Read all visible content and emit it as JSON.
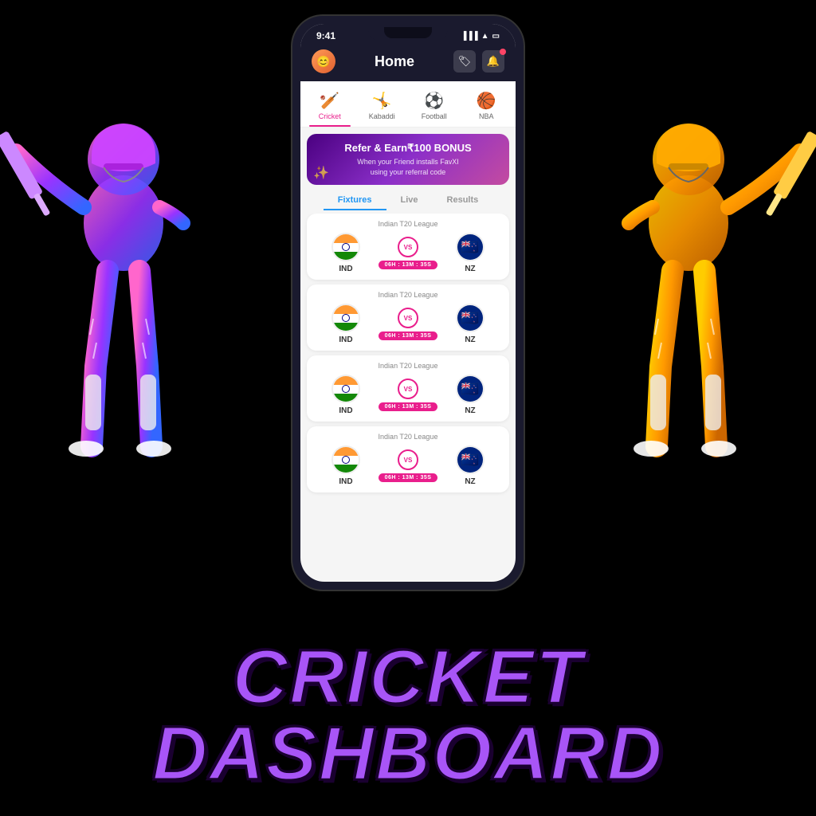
{
  "page": {
    "background": "#000000",
    "title": "CRICKET DASHBOARD"
  },
  "status_bar": {
    "time": "9:41",
    "signal": "▐▐▐",
    "wifi": "WiFi",
    "battery": "🔋"
  },
  "header": {
    "title": "Home",
    "avatar_icon": "👤",
    "tag_icon": "🏷",
    "bell_icon": "🔔"
  },
  "sport_tabs": [
    {
      "label": "Cricket",
      "icon": "🏏",
      "active": true
    },
    {
      "label": "Kabaddi",
      "icon": "🤸",
      "active": false
    },
    {
      "label": "Football",
      "icon": "⚽",
      "active": false
    },
    {
      "label": "NBA",
      "icon": "🏀",
      "active": false
    }
  ],
  "banner": {
    "title": "Refer & Earn₹100 BONUS",
    "subtitle": "When your Friend installs FavXI\nusing your referral code"
  },
  "match_tabs": [
    {
      "label": "Fixtures",
      "active": true
    },
    {
      "label": "Live",
      "active": false
    },
    {
      "label": "Results",
      "active": false
    }
  ],
  "matches": [
    {
      "league": "Indian T20 League",
      "team1": "IND",
      "team2": "NZ",
      "timer": "06H : 13M : 35S"
    },
    {
      "league": "Indian T20 League",
      "team1": "IND",
      "team2": "NZ",
      "timer": "06H : 13M : 35S"
    },
    {
      "league": "Indian T20 League",
      "team1": "IND",
      "team2": "NZ",
      "timer": "06H : 13M : 35S"
    },
    {
      "league": "Indian T20 League",
      "team1": "IND",
      "team2": "NZ",
      "timer": "06H : 13M : 35S"
    }
  ],
  "bottom_title": {
    "line1": "CRICKET",
    "line2": "DASHBOARD"
  }
}
